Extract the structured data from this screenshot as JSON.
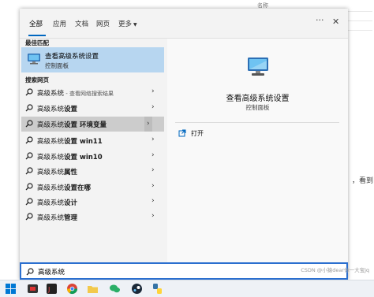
{
  "background": {
    "column_header": "名称",
    "side_text": "，看到",
    "watermark": "CSDN @小猿dear你一大宝jq"
  },
  "tabs": [
    {
      "label": "全部"
    },
    {
      "label": "应用"
    },
    {
      "label": "文档"
    },
    {
      "label": "网页"
    },
    {
      "label": "更多"
    }
  ],
  "sections": {
    "best_match": "最佳匹配",
    "web_search": "搜索网页"
  },
  "best_match": {
    "title": "查看高级系统设置",
    "subtitle": "控制面板"
  },
  "web_results": [
    {
      "prefix": "高级系统",
      "bold": "",
      "desc": " - 查看网络搜索结果"
    },
    {
      "prefix": "高级系统",
      "bold": "设置",
      "desc": ""
    },
    {
      "prefix": "高级系统",
      "bold": "设置 环境变量",
      "desc": ""
    },
    {
      "prefix": "高级系统",
      "bold": "设置 win11",
      "desc": ""
    },
    {
      "prefix": "高级系统",
      "bold": "设置 win10",
      "desc": ""
    },
    {
      "prefix": "高级系统",
      "bold": "属性",
      "desc": ""
    },
    {
      "prefix": "高级系统",
      "bold": "设置在哪",
      "desc": ""
    },
    {
      "prefix": "高级系统",
      "bold": "设计",
      "desc": ""
    },
    {
      "prefix": "高级系统",
      "bold": "管理",
      "desc": ""
    }
  ],
  "detail": {
    "title": "查看高级系统设置",
    "subtitle": "控制面板",
    "open_label": "打开"
  },
  "search": {
    "value": "高级系统"
  },
  "colors": {
    "accent": "#0067c0",
    "selection": "#b7d6f0",
    "hover": "#cccccc"
  },
  "icons": [
    "more-options-icon",
    "close-icon",
    "search-icon",
    "computer-monitor-icon",
    "open-icon",
    "chevron-right-icon",
    "windows-start-icon",
    "app-icon",
    "edge-icon",
    "chrome-icon",
    "wechat-icon",
    "folder-icon",
    "steam-icon",
    "python-icon"
  ]
}
